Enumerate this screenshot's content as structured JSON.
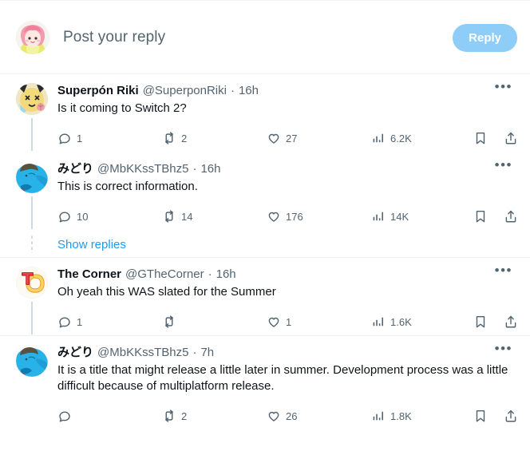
{
  "compose": {
    "placeholder": "Post your reply",
    "reply_label": "Reply",
    "avatar_name": "pink-haired-anime-girl-avatar"
  },
  "colors": {
    "accent_link": "#1d9bf0",
    "reply_button": "#8ecdf8",
    "text_primary": "#0f1419",
    "text_secondary": "#536471",
    "separator": "#eff3f4",
    "thread_line": "#cfd9de"
  },
  "show_replies_label": "Show replies",
  "tweets": [
    {
      "name": "Superpón Riki",
      "handle": "@SuperponRiki",
      "separator": "·",
      "time": "16h",
      "text": "Is it coming to Switch 2?",
      "more_label": "•••",
      "avatar_name": "pokemon-scribble-avatar",
      "actions": {
        "reply": "1",
        "retweet": "2",
        "like": "27",
        "views": "6.2K"
      }
    },
    {
      "name": "みどり",
      "handle": "@MbKKssTBhz5",
      "separator": "·",
      "time": "16h",
      "text": "This is correct information.",
      "more_label": "•••",
      "avatar_name": "blue-anime-character-avatar",
      "actions": {
        "reply": "10",
        "retweet": "14",
        "like": "176",
        "views": "14K"
      }
    },
    {
      "name": "The Corner",
      "handle": "@GTheCorner",
      "separator": "·",
      "time": "16h",
      "text": "Oh yeah this WAS slated for the Summer",
      "more_label": "•••",
      "avatar_name": "tc-logo-avatar",
      "actions": {
        "reply": "1",
        "retweet": "",
        "like": "1",
        "views": "1.6K"
      }
    },
    {
      "name": "みどり",
      "handle": "@MbKKssTBhz5",
      "separator": "·",
      "time": "7h",
      "text": "It is a title that might release a little later in summer. Development process was a little difficult because of multiplatform release.",
      "more_label": "•••",
      "avatar_name": "blue-anime-character-avatar",
      "actions": {
        "reply": "",
        "retweet": "2",
        "like": "26",
        "views": "1.8K"
      }
    }
  ],
  "icons": {
    "reply": "reply-bubble-icon",
    "retweet": "retweet-icon",
    "like": "heart-icon",
    "views": "views-bar-chart-icon",
    "bookmark": "bookmark-icon",
    "share": "share-upload-icon"
  }
}
